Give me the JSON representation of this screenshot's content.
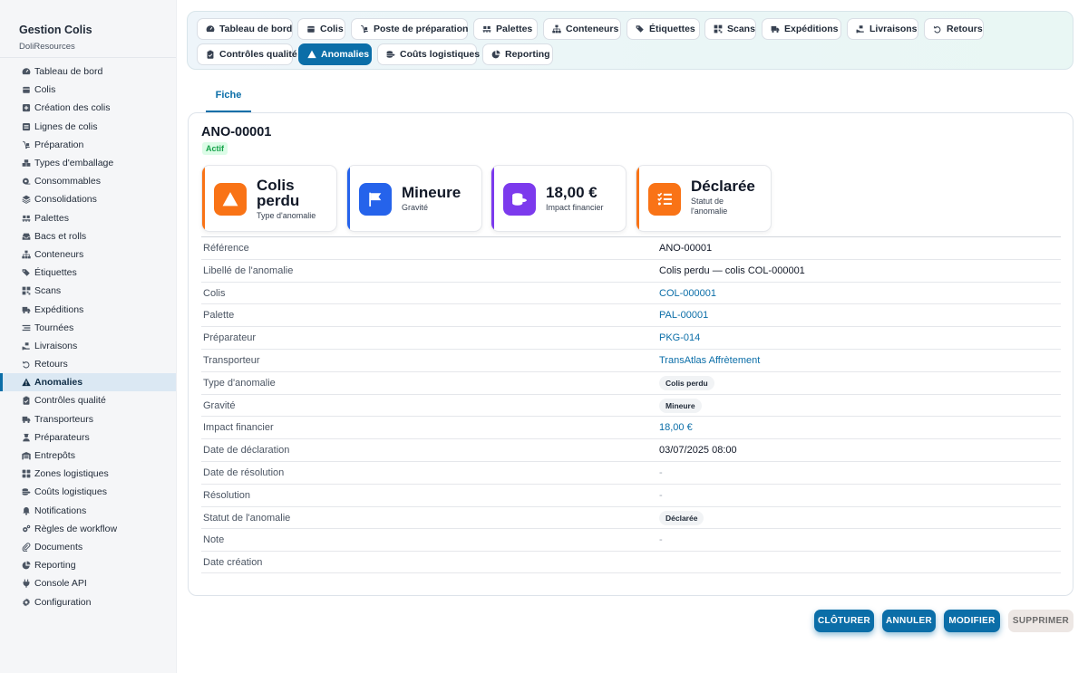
{
  "sidebar": {
    "title": "Gestion Colis",
    "subtitle": "DoliResources",
    "items": [
      {
        "label": "Tableau de bord",
        "icon": "dashboard-icon"
      },
      {
        "label": "Colis",
        "icon": "box-icon"
      },
      {
        "label": "Création des colis",
        "icon": "plus-square-icon"
      },
      {
        "label": "Lignes de colis",
        "icon": "list-icon"
      },
      {
        "label": "Préparation",
        "icon": "dolly-icon"
      },
      {
        "label": "Types d'emballage",
        "icon": "boxes-icon"
      },
      {
        "label": "Consommables",
        "icon": "tape-icon"
      },
      {
        "label": "Consolidations",
        "icon": "layer-icon"
      },
      {
        "label": "Palettes",
        "icon": "pallet-icon"
      },
      {
        "label": "Bacs et rolls",
        "icon": "inbox-icon"
      },
      {
        "label": "Conteneurs",
        "icon": "sitemap-icon"
      },
      {
        "label": "Étiquettes",
        "icon": "tags-icon"
      },
      {
        "label": "Scans",
        "icon": "scan-icon"
      },
      {
        "label": "Expéditions",
        "icon": "truck-icon"
      },
      {
        "label": "Tournées",
        "icon": "route-icon"
      },
      {
        "label": "Livraisons",
        "icon": "delivery-icon"
      },
      {
        "label": "Retours",
        "icon": "undo-icon"
      },
      {
        "label": "Anomalies",
        "icon": "warning-icon"
      },
      {
        "label": "Contrôles qualité",
        "icon": "clipboard-check-icon"
      },
      {
        "label": "Transporteurs",
        "icon": "truck-icon"
      },
      {
        "label": "Préparateurs",
        "icon": "user-worker-icon"
      },
      {
        "label": "Entrepôts",
        "icon": "warehouse-icon"
      },
      {
        "label": "Zones logistiques",
        "icon": "grid-icon"
      },
      {
        "label": "Coûts logistiques",
        "icon": "coins-icon"
      },
      {
        "label": "Notifications",
        "icon": "bell-icon"
      },
      {
        "label": "Règles de workflow",
        "icon": "cogs-icon"
      },
      {
        "label": "Documents",
        "icon": "paperclip-icon"
      },
      {
        "label": "Reporting",
        "icon": "chart-pie-icon"
      },
      {
        "label": "Console API",
        "icon": "plug-icon"
      },
      {
        "label": "Configuration",
        "icon": "gear-icon"
      }
    ],
    "active_index": 17
  },
  "topnav": {
    "tabs": [
      {
        "label": "Tableau de bord",
        "icon": "dashboard-icon"
      },
      {
        "label": "Colis",
        "icon": "box-icon"
      },
      {
        "label": "Poste de préparation",
        "icon": "dolly-icon"
      },
      {
        "label": "Palettes",
        "icon": "pallet-icon"
      },
      {
        "label": "Conteneurs",
        "icon": "sitemap-icon"
      },
      {
        "label": "Étiquettes",
        "icon": "tags-icon"
      },
      {
        "label": "Scans",
        "icon": "scan-icon"
      },
      {
        "label": "Expéditions",
        "icon": "truck-icon"
      },
      {
        "label": "Livraisons",
        "icon": "delivery-icon"
      },
      {
        "label": "Retours",
        "icon": "undo-icon"
      },
      {
        "label": "Contrôles qualité",
        "icon": "clipboard-check-icon"
      },
      {
        "label": "Anomalies",
        "icon": "warning-icon"
      },
      {
        "label": "Coûts logistiques",
        "icon": "coins-icon"
      },
      {
        "label": "Reporting",
        "icon": "chart-pie-icon"
      }
    ],
    "active_index": 11
  },
  "subtab": {
    "label": "Fiche"
  },
  "record": {
    "ref": "ANO-00001",
    "status_badge": "Actif"
  },
  "kpis": [
    {
      "value": "Colis perdu",
      "label": "Type d'anomalie",
      "icon": "warning-icon",
      "color": "#f97316"
    },
    {
      "value": "Mineure",
      "label": "Gravité",
      "icon": "flag-icon",
      "color": "#2563eb"
    },
    {
      "value": "18,00 €",
      "label": "Impact financier",
      "icon": "coins-icon",
      "color": "#7c3aed"
    },
    {
      "value": "Déclarée",
      "label": "Statut de l'anomalie",
      "icon": "tasks-icon",
      "color": "#f97316"
    }
  ],
  "details": [
    {
      "label": "Référence",
      "value": "ANO-00001",
      "kind": "text"
    },
    {
      "label": "Libellé de l'anomalie",
      "value": "Colis perdu — colis COL-000001",
      "kind": "text"
    },
    {
      "label": "Colis",
      "value": "COL-000001",
      "kind": "link"
    },
    {
      "label": "Palette",
      "value": "PAL-00001",
      "kind": "link"
    },
    {
      "label": "Préparateur",
      "value": "PKG-014",
      "kind": "link"
    },
    {
      "label": "Transporteur",
      "value": "TransAtlas Affrètement",
      "kind": "link"
    },
    {
      "label": "Type d'anomalie",
      "value": "Colis perdu",
      "kind": "pill"
    },
    {
      "label": "Gravité",
      "value": "Mineure",
      "kind": "pill"
    },
    {
      "label": "Impact financier",
      "value": "18,00 €",
      "kind": "link"
    },
    {
      "label": "Date de déclaration",
      "value": "03/07/2025 08:00",
      "kind": "text"
    },
    {
      "label": "Date de résolution",
      "value": "-",
      "kind": "muted"
    },
    {
      "label": "Résolution",
      "value": "-",
      "kind": "muted"
    },
    {
      "label": "Statut de l'anomalie",
      "value": "Déclarée",
      "kind": "pill"
    },
    {
      "label": "Note",
      "value": "-",
      "kind": "muted"
    },
    {
      "label": "Date création",
      "value": "",
      "kind": "text"
    }
  ],
  "actions": {
    "close_label": "CLÔTURER",
    "cancel_label": "ANNULER",
    "edit_label": "MODIFIER",
    "delete_label": "SUPPRIMER"
  },
  "colors": {
    "accent": "#0b6ea8",
    "success": "#16a34a"
  }
}
